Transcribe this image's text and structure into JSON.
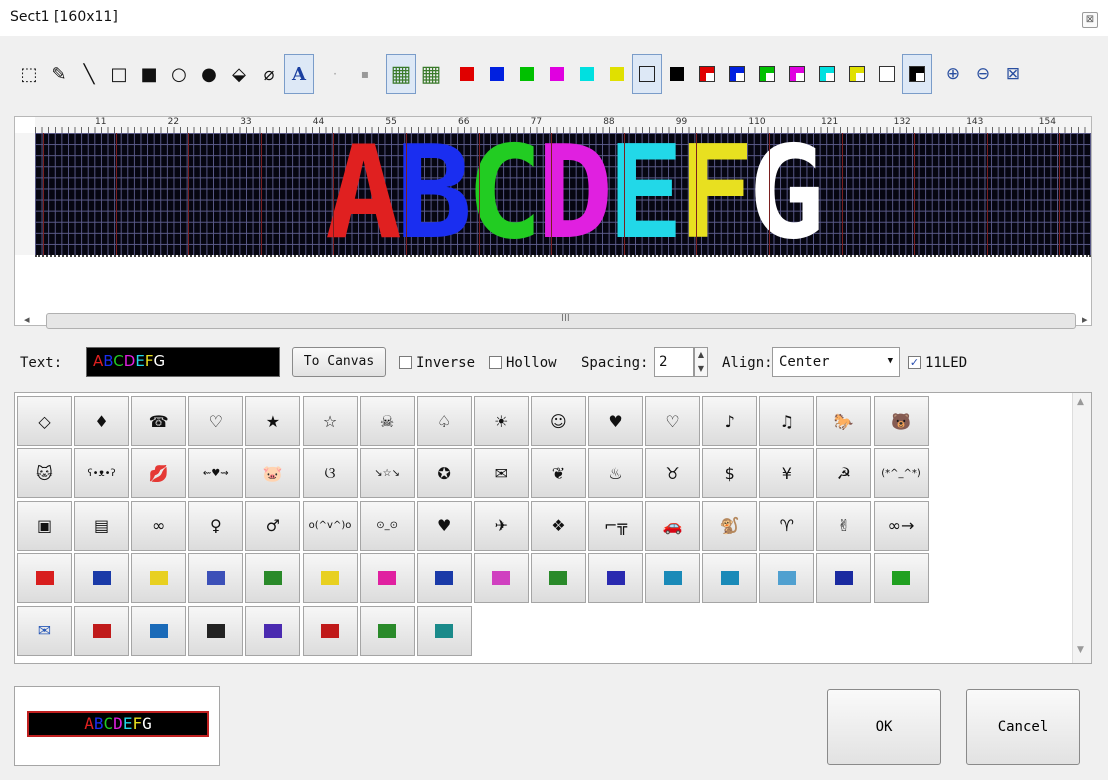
{
  "window": {
    "title": "Sect1 [160x11]",
    "close_glyph": "⊠"
  },
  "toolbar": {
    "items": [
      {
        "name": "select-rect-tool",
        "glyph": "⬚"
      },
      {
        "name": "pencil-tool",
        "glyph": "✎"
      },
      {
        "name": "line-tool",
        "glyph": "╲"
      },
      {
        "name": "rectangle-tool",
        "glyph": "□"
      },
      {
        "name": "filled-rectangle-tool",
        "glyph": "■"
      },
      {
        "name": "ellipse-tool",
        "glyph": "○"
      },
      {
        "name": "filled-ellipse-tool",
        "glyph": "●"
      },
      {
        "name": "fill-bucket-tool",
        "glyph": "⬙"
      },
      {
        "name": "eraser-tool",
        "glyph": "⌀"
      },
      {
        "name": "text-tool",
        "glyph": "A"
      },
      {
        "name": "dot-small-tool",
        "glyph": "·"
      },
      {
        "name": "dot-large-tool",
        "glyph": "▪"
      },
      {
        "name": "import-image-tool",
        "glyph": "▦"
      },
      {
        "name": "export-image-tool",
        "glyph": "▦"
      }
    ],
    "colors": [
      "#e00000",
      "#0020e0",
      "#00c000",
      "#e000e0",
      "#00e0e0",
      "#e0e000",
      "#ffffff",
      "#000000"
    ],
    "split_colors": [
      "#e00000",
      "#0020e0",
      "#00c000",
      "#e000e0",
      "#00e0e0",
      "#e0e000",
      "#ffffff",
      "#000000"
    ],
    "zoom_items": [
      {
        "name": "zoom-in-tool",
        "glyph": "⊕"
      },
      {
        "name": "zoom-out-tool",
        "glyph": "⊖"
      },
      {
        "name": "zoom-fit-tool",
        "glyph": "⊠"
      }
    ]
  },
  "ruler": {
    "labels": [
      "11",
      "22",
      "33",
      "44",
      "55",
      "66",
      "77",
      "88",
      "99",
      "110",
      "121",
      "132",
      "143",
      "154"
    ]
  },
  "canvas": {
    "letters": [
      {
        "ch": "A",
        "color": "#e02020"
      },
      {
        "ch": "B",
        "color": "#1a2ef0"
      },
      {
        "ch": "C",
        "color": "#22cc22"
      },
      {
        "ch": "D",
        "color": "#e020e0"
      },
      {
        "ch": "E",
        "color": "#22d8e8"
      },
      {
        "ch": "F",
        "color": "#e8e020"
      },
      {
        "ch": "G",
        "color": "#ffffff"
      }
    ]
  },
  "scrollbar": {
    "grip": "III",
    "left_arrow": "◂",
    "right_arrow": "▸"
  },
  "controls": {
    "text_label": "Text:",
    "text_value": "ABCDEFG",
    "to_canvas_label": "To Canvas",
    "inverse_label": "Inverse",
    "inverse_checked": false,
    "hollow_label": "Hollow",
    "hollow_checked": false,
    "spacing_label": "Spacing:",
    "spacing_value": "2",
    "align_label": "Align:",
    "align_value": "Center",
    "led11_label": "11LED",
    "led11_checked": true
  },
  "symbols": [
    [
      "◇",
      "♦",
      "☎",
      "♡",
      "★",
      "☆",
      "☠",
      "♤",
      "☀",
      "☺",
      "♥",
      "♡",
      "♪",
      "♫",
      "🐎",
      "🐻"
    ],
    [
      "🐱",
      "ʕ•ᴥ•ʔ",
      "💋",
      "⇜♥⇝",
      "🐷",
      "ଓ",
      "↘☆↘",
      "✪",
      "✉",
      "❦",
      "♨",
      "♉",
      "$",
      "¥",
      "☭",
      "(*^_^*)"
    ],
    [
      "▣",
      "▤",
      "∞",
      "♀",
      "♂",
      "o(^v^)o",
      "⊙_⊙",
      "♥",
      "✈",
      "❖",
      "⌐╦",
      "🚗",
      "🐒",
      "♈",
      "✌",
      "∞→"
    ],
    [
      "▮",
      "▮",
      "▮",
      "▮",
      "▮",
      "▮",
      "▮",
      "▮",
      "▮",
      "▮",
      "▮",
      "▮",
      "▮",
      "▮",
      "▮",
      "▮"
    ],
    [
      "✉",
      "▮",
      "▮",
      "▮",
      "▮",
      "▮",
      "▮",
      "▮"
    ]
  ],
  "color_symbols": {
    "row4": [
      "#d81e1e",
      "#1a3aa8",
      "#e8d020",
      "#3c50b8",
      "#2a8a2a",
      "#e8d020",
      "#e020a0",
      "#1a3aa8",
      "#d040c0",
      "#2a8a2a",
      "#2a2ab0",
      "#1a8ab8",
      "#1a8ab8",
      "#50a0d0",
      "#1a2aa0",
      "#20a020"
    ],
    "row5": [
      "#2a5ab8",
      "#c01a1a",
      "#1a6ab8",
      "#222222",
      "#4a2ab0",
      "#c01a1a",
      "#2a8a2a",
      "#1a8a8a"
    ]
  },
  "preview": {
    "text": "ABCDEFG"
  },
  "buttons": {
    "ok": "OK",
    "cancel": "Cancel"
  }
}
